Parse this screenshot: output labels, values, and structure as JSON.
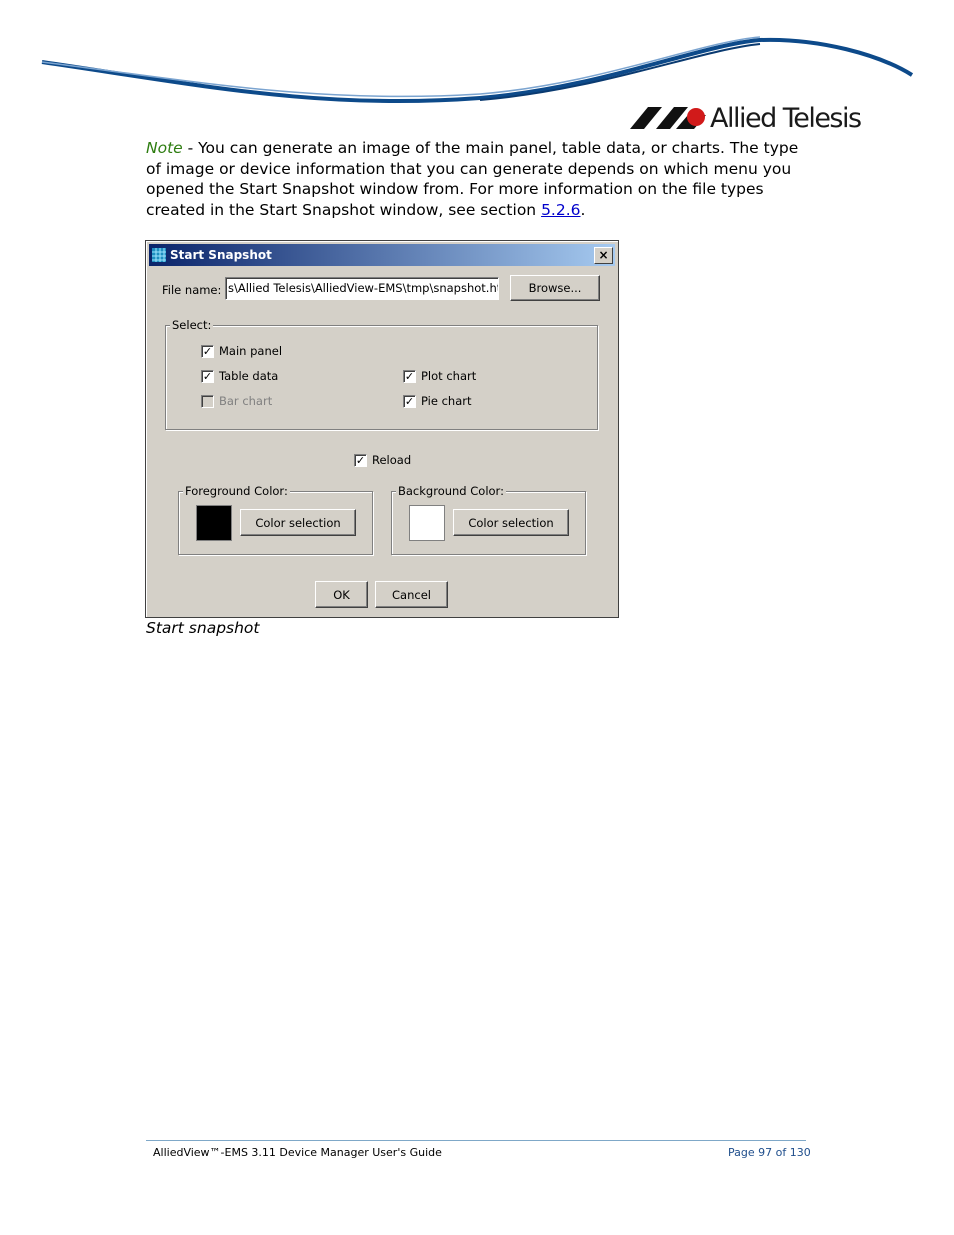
{
  "logo": {
    "company": "Allied Telesis"
  },
  "note": {
    "label": "Note",
    "text_before": " - You can generate an image of the main panel, table data, or charts. The type of image or device information that you can generate depends on which menu you opened the Start Snapshot window from. For more information on the file types created in the Start Snapshot window, see section ",
    "link": "5.2.6",
    "text_after": "."
  },
  "dialog": {
    "title": "Start Snapshot",
    "close": "×",
    "file_name_label": "File name:",
    "file_name_value": "s\\Allied Telesis\\AlliedView-EMS\\tmp\\snapshot.htm",
    "browse_label": "Browse...",
    "select_group_label": "Select:",
    "options": {
      "main_panel": {
        "label": "Main panel",
        "checked": true
      },
      "table_data": {
        "label": "Table data",
        "checked": true
      },
      "bar_chart": {
        "label": "Bar chart",
        "checked": false,
        "disabled": true
      },
      "plot_chart": {
        "label": "Plot chart",
        "checked": true
      },
      "pie_chart": {
        "label": "Pie chart",
        "checked": true
      }
    },
    "reload": {
      "label": "Reload",
      "checked": true
    },
    "foreground": {
      "group_label": "Foreground Color:",
      "button_label": "Color selection",
      "color": "#000000"
    },
    "background": {
      "group_label": "Background Color:",
      "button_label": "Color selection",
      "color": "#ffffff"
    },
    "ok_label": "OK",
    "cancel_label": "Cancel"
  },
  "caption": "Start snapshot",
  "footer": {
    "left": "AlliedView™-EMS 3.11 Device Manager User's Guide",
    "right": "Page 97 of 130"
  },
  "check_mark": "✓"
}
